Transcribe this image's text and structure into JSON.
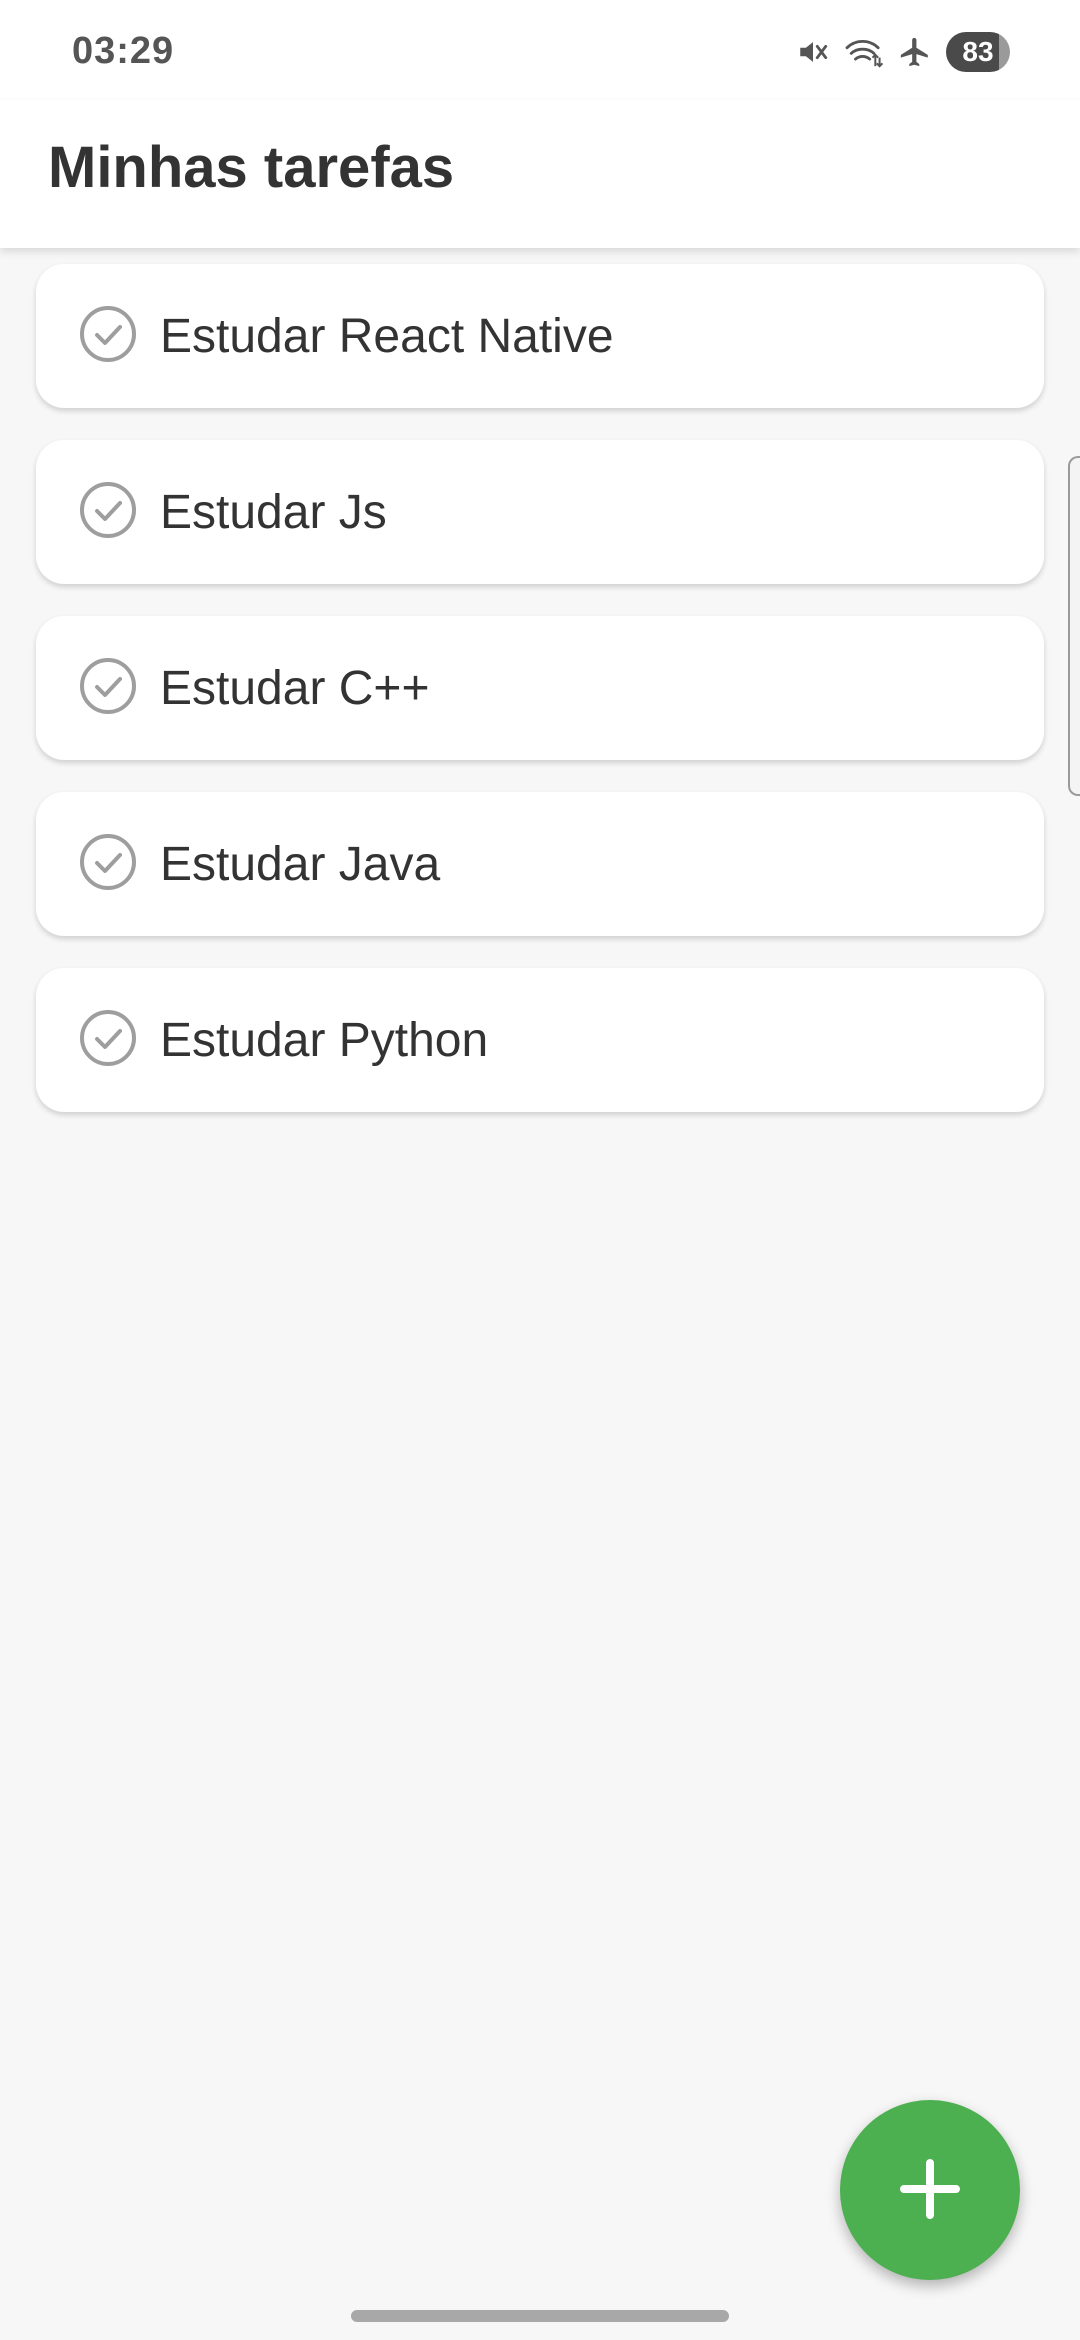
{
  "status_bar": {
    "time": "03:29",
    "battery_level": "83",
    "icons": [
      "mute-icon",
      "wifi-icon",
      "airplane-icon",
      "battery-icon"
    ]
  },
  "header": {
    "title": "Minhas tarefas"
  },
  "tasks": [
    {
      "label": "Estudar React Native",
      "icon": "check-circle-icon"
    },
    {
      "label": "Estudar Js",
      "icon": "check-circle-icon"
    },
    {
      "label": "Estudar C++",
      "icon": "check-circle-icon"
    },
    {
      "label": "Estudar Java",
      "icon": "check-circle-icon"
    },
    {
      "label": "Estudar Python",
      "icon": "check-circle-icon"
    }
  ],
  "fab": {
    "icon": "plus-icon"
  },
  "colors": {
    "accent": "#4caf50",
    "background": "#f7f7f7",
    "card": "#ffffff",
    "text": "#333333",
    "icon_gray": "#9e9e9e"
  }
}
